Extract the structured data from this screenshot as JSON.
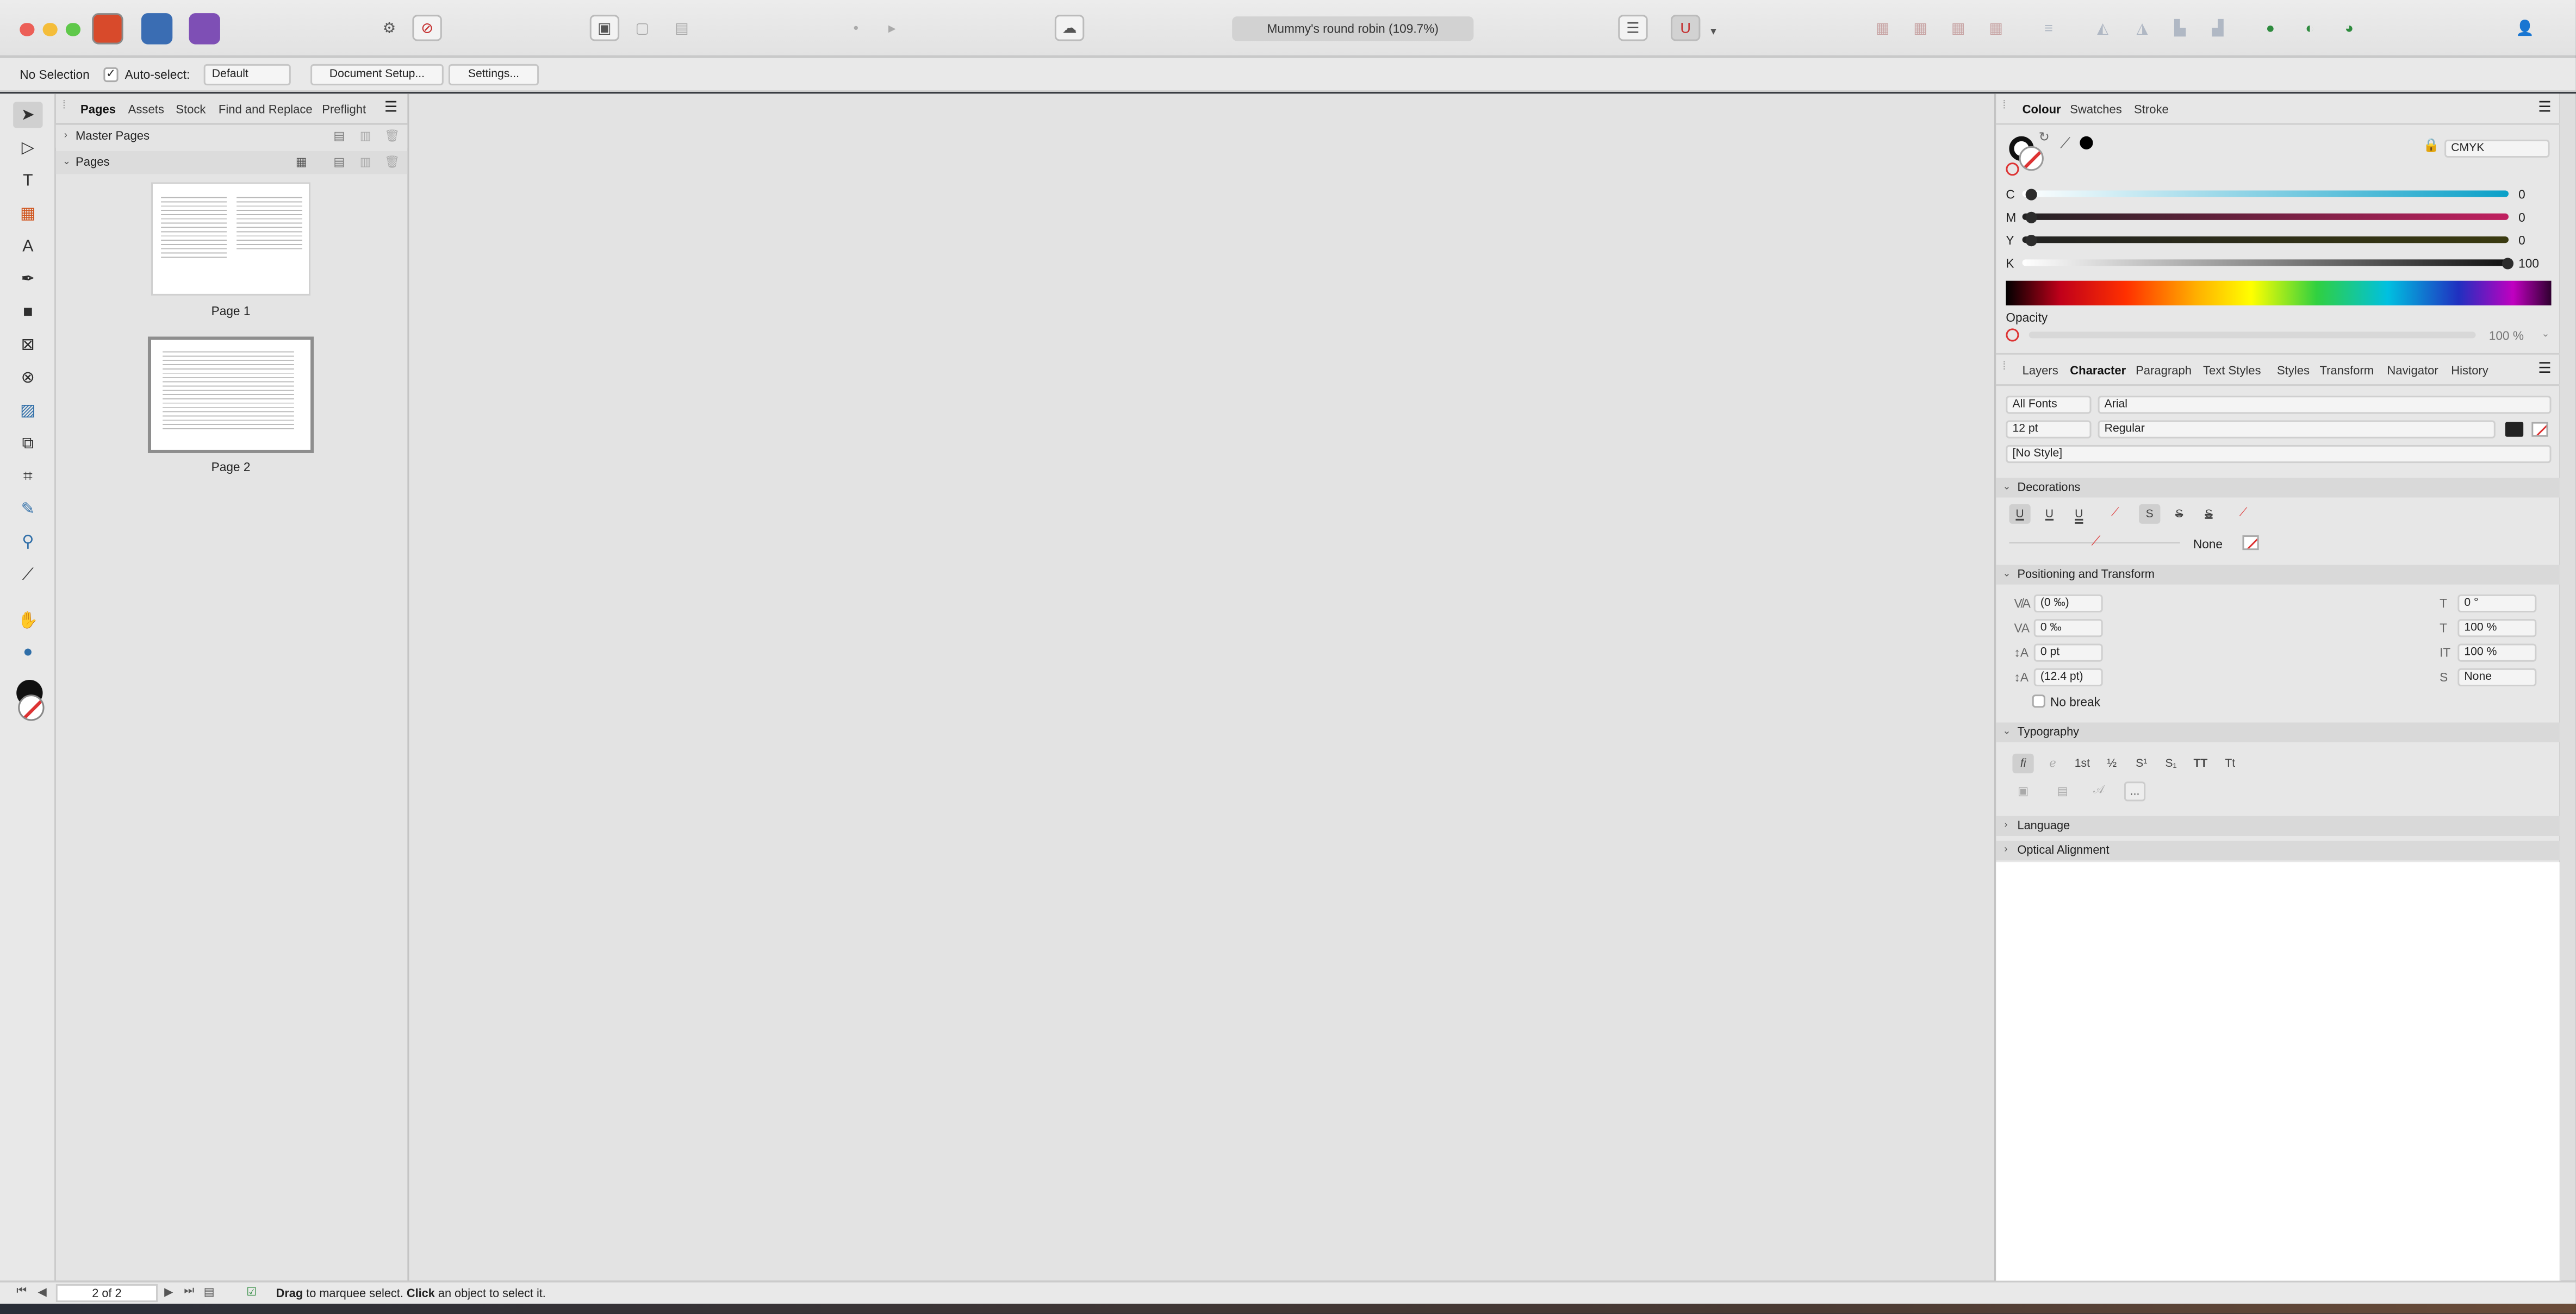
{
  "titlebar": {
    "document_title": "Mummy's round robin (109.7%)"
  },
  "context": {
    "selection": "No Selection",
    "autoselect_label": "Auto-select:",
    "autoselect_value": "Default",
    "doc_setup": "Document Setup...",
    "settings": "Settings..."
  },
  "left_panel": {
    "tabs": [
      "Pages",
      "Assets",
      "Stock",
      "Find and Replace",
      "Preflight"
    ],
    "master_pages": "Master Pages",
    "pages_label": "Pages",
    "pages": [
      {
        "label": "Page 1"
      },
      {
        "label": "Page 2"
      }
    ]
  },
  "colour_panel": {
    "tabs": [
      "Colour",
      "Swatches",
      "Stroke"
    ],
    "model": "CMYK",
    "channels": [
      {
        "label": "C",
        "value": "0",
        "fraction": 0
      },
      {
        "label": "M",
        "value": "0",
        "fraction": 0
      },
      {
        "label": "Y",
        "value": "0",
        "fraction": 0
      },
      {
        "label": "K",
        "value": "100",
        "fraction": 1
      }
    ],
    "opacity_label": "Opacity",
    "opacity_value": "100 %"
  },
  "character_panel": {
    "tabs": [
      "Layers",
      "Character",
      "Paragraph",
      "Text Styles",
      "Styles",
      "Transform",
      "Navigator",
      "History"
    ],
    "font_collection": "All Fonts",
    "font_family": "Arial",
    "font_size": "12 pt",
    "font_style": "Regular",
    "style": "[No Style]",
    "decorations_header": "Decorations",
    "decoration_glyphs": [
      "U",
      "U",
      "U",
      "S",
      "S",
      "S"
    ],
    "decoration_none": "None",
    "pos_header": "Positioning and Transform",
    "pos_left": [
      "(0 ‰)",
      "0 ‰",
      "0 pt",
      "(12.4 pt)"
    ],
    "pos_right": [
      "0 °",
      "100 %",
      "100 %",
      "None"
    ],
    "no_break": "No break",
    "typo_header": "Typography",
    "typo_glyphs": [
      "fi",
      "ℯ",
      "1st",
      "½",
      "S¹",
      "S₁",
      "TT",
      "Tt"
    ],
    "typo_more": "...",
    "language_header": "Language",
    "optical_header": "Optical Alignment"
  },
  "status": {
    "page_indicator": "2 of 2",
    "hint_drag": "Drag",
    "hint_mid": " to marquee select. ",
    "hint_click": "Click",
    "hint_end": " an object to select it."
  },
  "colors": {
    "accent": "#c42d2d",
    "ui_bg": "#e4e4e4",
    "canvas": "#e3e3e3"
  }
}
